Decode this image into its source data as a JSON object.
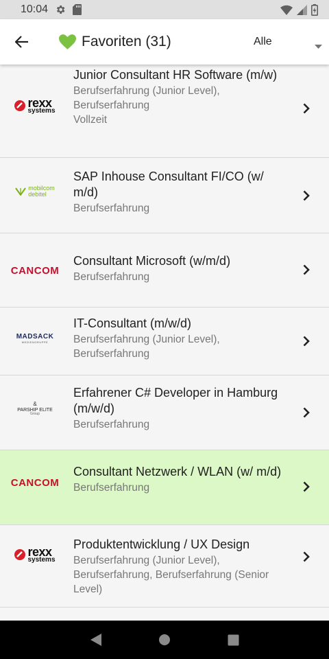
{
  "status_bar": {
    "time": "10:04"
  },
  "app_bar": {
    "title": "Favoriten (31)",
    "filter_value": "Alle"
  },
  "colors": {
    "heart": "#7cc242",
    "highlight": "#dcf8c6",
    "cancom": "#c8102e",
    "rexx_dot": "#d81f2a"
  },
  "logos": {
    "rexx": {
      "main": "rexx",
      "sub": "systems"
    },
    "cancom": "CANCOM",
    "mobilcom": {
      "line1": "mobilcom",
      "line2": "debitel"
    },
    "madsack": {
      "main": "MADSACK",
      "sub": "MEDIENGRUPPE"
    },
    "parship": {
      "amp": "&",
      "main": "PARSHIP ELITE",
      "sub": "Group"
    }
  },
  "jobs": [
    {
      "title": "Junior Consultant HR Software (m/w)",
      "lines": [
        "Berufserfahrung (Junior Level), Berufserfahrung",
        "Vollzeit"
      ],
      "logo": "rexx",
      "highlighted": false
    },
    {
      "title": "SAP Inhouse Consultant FI/CO (w/ m/d)",
      "lines": [
        "Berufserfahrung"
      ],
      "logo": "mobilcom",
      "highlighted": false
    },
    {
      "title": "Consultant Microsoft (w/m/d)",
      "lines": [
        "Berufserfahrung"
      ],
      "logo": "cancom",
      "highlighted": false
    },
    {
      "title": "IT-Consultant (m/w/d)",
      "lines": [
        "Berufserfahrung (Junior Level), Berufserfahrung"
      ],
      "logo": "madsack",
      "highlighted": false
    },
    {
      "title": "Erfahrener C# Developer in Hamburg (m/w/d)",
      "lines": [
        "Berufserfahrung"
      ],
      "logo": "parship",
      "highlighted": false
    },
    {
      "title": "Consultant Netzwerk / WLAN (w/ m/d)",
      "lines": [
        "Berufserfahrung"
      ],
      "logo": "cancom",
      "highlighted": true
    },
    {
      "title": "Produktentwicklung / UX Design",
      "lines": [
        "Berufserfahrung (Junior Level), Berufserfahrung, Berufserfahrung (Senior Level)"
      ],
      "logo": "rexx",
      "highlighted": false
    }
  ]
}
